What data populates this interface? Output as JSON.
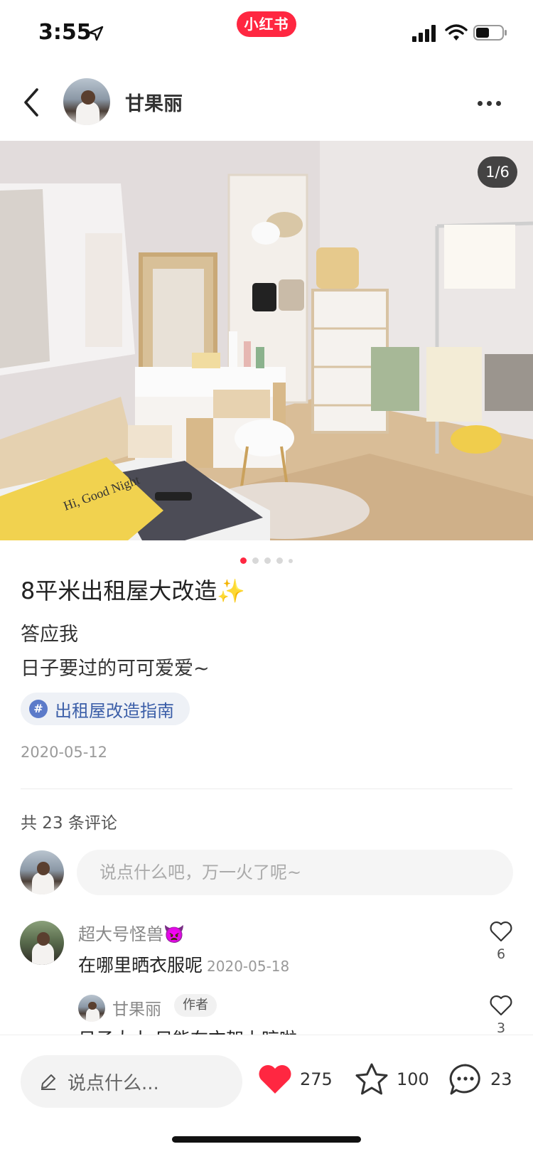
{
  "status_bar": {
    "time": "3:55",
    "brand": "小红书"
  },
  "header": {
    "author_name": "甘果丽"
  },
  "photo": {
    "counter": "1/6",
    "pillow_text": "Hi, Good Night"
  },
  "note": {
    "title": "8平米出租屋大改造",
    "title_emoji": "✨",
    "body_lines": [
      "答应我",
      "日子要过的可可爱爱~"
    ],
    "tag": {
      "icon": "#",
      "label": "出租屋改造指南"
    },
    "date": "2020-05-12"
  },
  "comments": {
    "count_label": "共 23 条评论",
    "input_placeholder": "说点什么吧，万一火了呢~",
    "items": [
      {
        "name": "超大号怪兽",
        "emoji": "👿",
        "text": "在哪里晒衣服呢",
        "date": "2020-05-18",
        "likes": "6"
      }
    ],
    "reply": {
      "name": "甘果丽",
      "badge": "作者",
      "text": "日子太小 只能在衣架上晾啦",
      "likes": "3"
    }
  },
  "bottom_bar": {
    "input_placeholder": "说点什么...",
    "likes": "275",
    "collects": "100",
    "comments": "23"
  },
  "colors": {
    "brand": "#ff2741",
    "tag": "#3b5ea8"
  }
}
